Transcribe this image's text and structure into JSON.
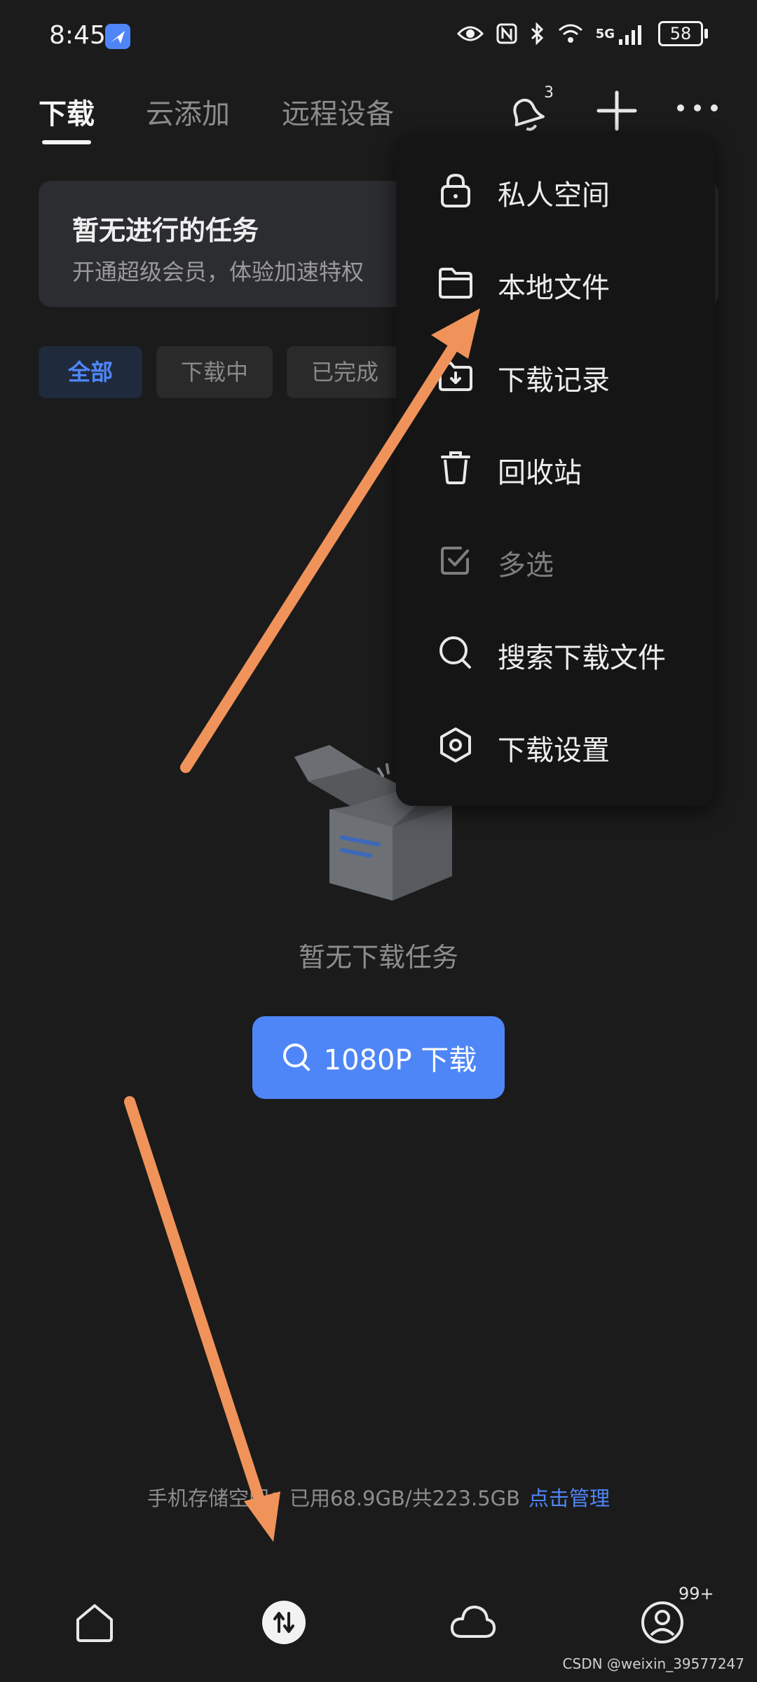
{
  "status_bar": {
    "time": "8:45",
    "network": "5G",
    "battery": "58",
    "icons": [
      "eye-icon",
      "nfc-icon",
      "bluetooth-icon",
      "wifi-icon",
      "signal-icon"
    ]
  },
  "tabs": [
    {
      "label": "下载",
      "active": true
    },
    {
      "label": "云添加",
      "active": false
    },
    {
      "label": "远程设备",
      "active": false
    }
  ],
  "top_actions": {
    "notification_count": "3",
    "icons": [
      "bell-icon",
      "plus-icon",
      "more-icon"
    ]
  },
  "promo": {
    "title": "暂无进行的任务",
    "subtitle": "开通超级会员，体验加速特权"
  },
  "filters": [
    {
      "label": "全部",
      "active": true
    },
    {
      "label": "下载中",
      "active": false
    },
    {
      "label": "已完成",
      "active": false
    }
  ],
  "empty_state": {
    "text": "暂无下载任务",
    "button_label": "1080P 下载"
  },
  "storage": {
    "text": "手机存储空间：已用68.9GB/共223.5GB",
    "manage_label": "点击管理"
  },
  "bottom_nav": {
    "profile_badge": "99+",
    "icons": [
      "home-icon",
      "transfer-icon",
      "cloud-icon",
      "profile-icon"
    ]
  },
  "menu": {
    "items": [
      {
        "label": "私人空间",
        "icon": "lock-icon",
        "enabled": true
      },
      {
        "label": "本地文件",
        "icon": "folder-icon",
        "enabled": true
      },
      {
        "label": "下载记录",
        "icon": "download-record-icon",
        "enabled": true
      },
      {
        "label": "回收站",
        "icon": "trash-icon",
        "enabled": true
      },
      {
        "label": "多选",
        "icon": "checkbox-icon",
        "enabled": false
      },
      {
        "label": "搜索下载文件",
        "icon": "search-icon",
        "enabled": true
      },
      {
        "label": "下载设置",
        "icon": "settings-icon",
        "enabled": true
      }
    ]
  },
  "watermark": "CSDN @weixin_39577247",
  "colors": {
    "background": "#1b1b1b",
    "accent": "#4f86f7",
    "menu_bg": "#151515",
    "annotation_arrow": "#f0935a"
  }
}
